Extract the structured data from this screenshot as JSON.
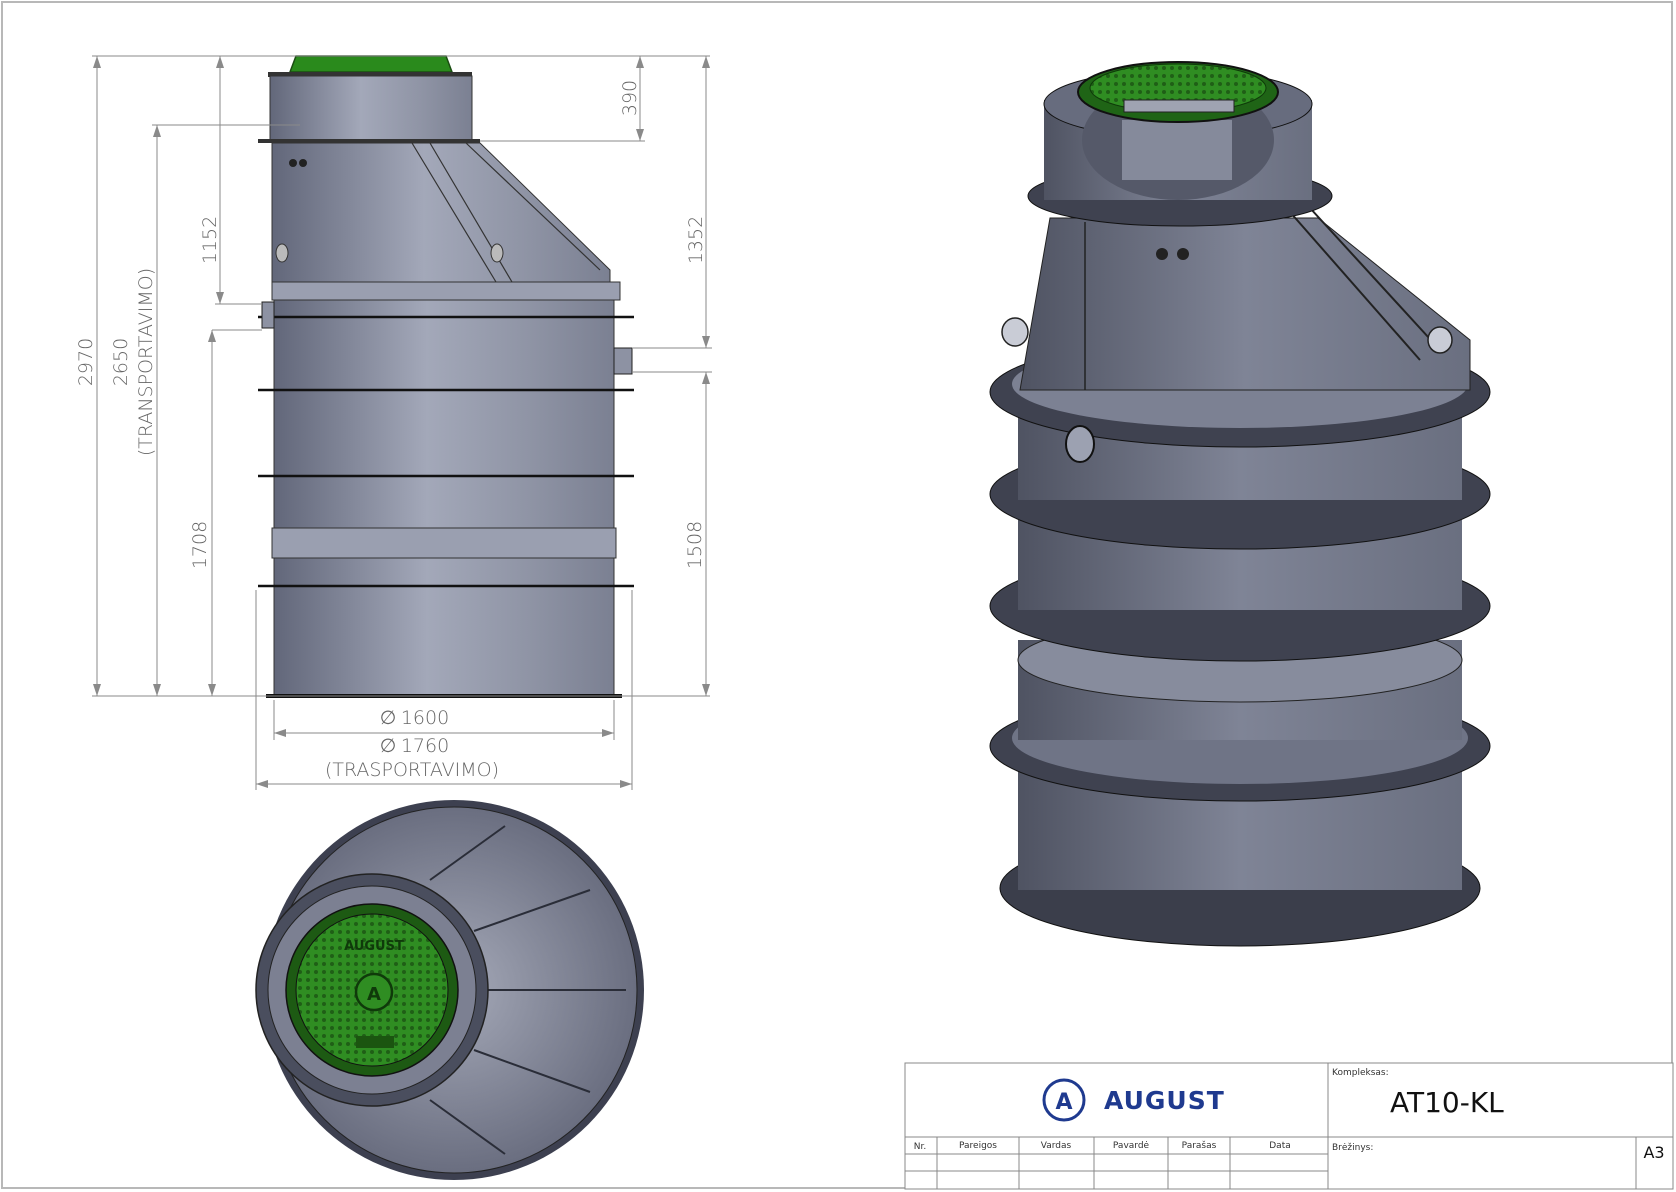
{
  "dimensions": {
    "d390": "390",
    "d1152": "1152",
    "d1352": "1352",
    "d2970": "2970",
    "d2650": "2650",
    "d2650_note": "(TRANSPORTAVIMO)",
    "d1708": "1708",
    "d1508": "1508",
    "dia1600": "1600",
    "dia1760": "1760",
    "dia1760_note": "(TRASPORTAVIMO)",
    "dia_symbol": "∅"
  },
  "lid_text": "AUGUST",
  "title_block": {
    "brand": "AUGUST",
    "kompleksas_label": "Kompleksas:",
    "kompleksas_value": "AT10-KL",
    "brezinys_label": "Brėžinys:",
    "sheet_size": "A3",
    "columns": [
      "Nr.",
      "Pareigos",
      "Vardas",
      "Pavardė",
      "Parašas",
      "Data"
    ]
  },
  "colors": {
    "body": "#8e93a4",
    "body_dark": "#5d6170",
    "lid_green": "#2e8a1e",
    "dim_line": "#8a8a8a",
    "brand_blue": "#1f3a8f"
  }
}
